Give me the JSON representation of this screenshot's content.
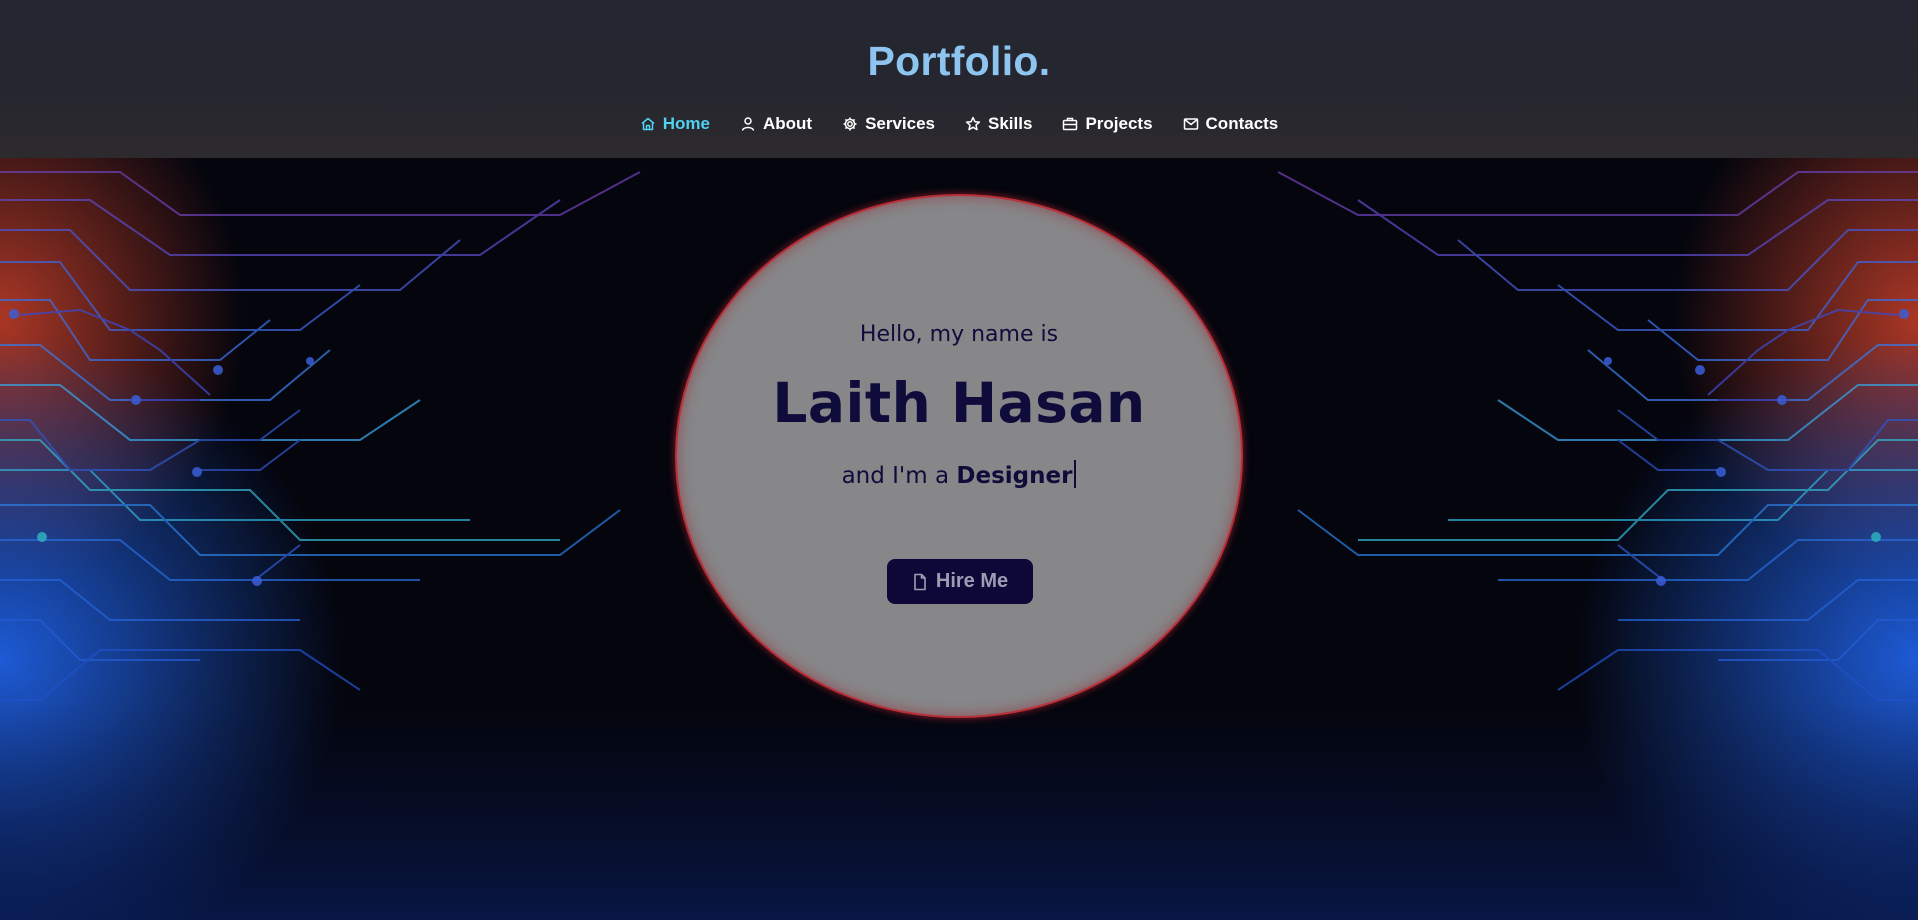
{
  "header": {
    "logo": "Portfolio.",
    "nav": [
      {
        "label": "Home",
        "icon": "home-icon",
        "active": true
      },
      {
        "label": "About",
        "icon": "user-icon",
        "active": false
      },
      {
        "label": "Services",
        "icon": "gear-icon",
        "active": false
      },
      {
        "label": "Skills",
        "icon": "star-icon",
        "active": false
      },
      {
        "label": "Projects",
        "icon": "briefcase-icon",
        "active": false
      },
      {
        "label": "Contacts",
        "icon": "mail-icon",
        "active": false
      }
    ]
  },
  "hero": {
    "greeting": "Hello, my name is",
    "name": "Laith Hasan",
    "role_prefix": "and I'm a",
    "role": "Designer",
    "cta_label": "Hire Me",
    "cta_icon": "file-icon"
  },
  "colors": {
    "accent": "#4fd2f0",
    "logo": "#8ec4f0",
    "hero_text": "#0f0b3a",
    "circle": "#878789",
    "circle_border": "#b8303a",
    "button": "#0e0839"
  }
}
